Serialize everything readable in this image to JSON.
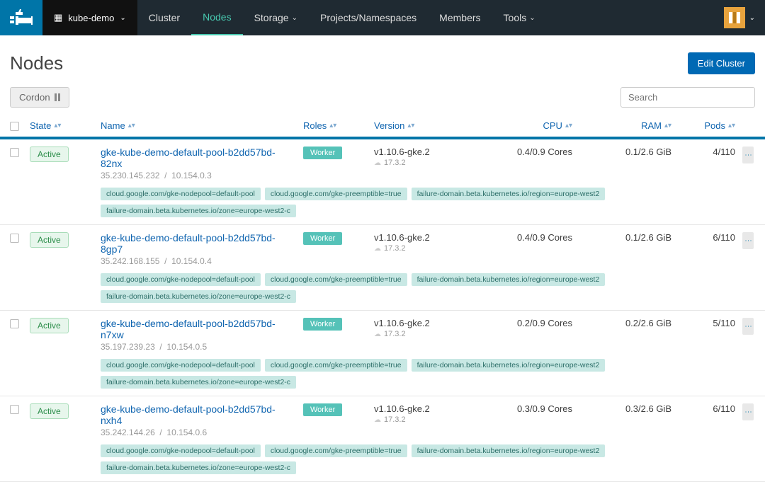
{
  "nav": {
    "cluster_name": "kube-demo",
    "items": [
      {
        "label": "Cluster",
        "active": false,
        "has_dd": false
      },
      {
        "label": "Nodes",
        "active": true,
        "has_dd": false
      },
      {
        "label": "Storage",
        "active": false,
        "has_dd": true
      },
      {
        "label": "Projects/Namespaces",
        "active": false,
        "has_dd": false
      },
      {
        "label": "Members",
        "active": false,
        "has_dd": false
      },
      {
        "label": "Tools",
        "active": false,
        "has_dd": true
      }
    ]
  },
  "page": {
    "title": "Nodes",
    "edit_button": "Edit Cluster"
  },
  "toolbar": {
    "cordon": "Cordon",
    "search_placeholder": "Search"
  },
  "columns": {
    "state": "State",
    "name": "Name",
    "roles": "Roles",
    "version": "Version",
    "cpu": "CPU",
    "ram": "RAM",
    "pods": "Pods"
  },
  "role_label": "Worker",
  "labels": [
    "cloud.google.com/gke-nodepool=default-pool",
    "cloud.google.com/gke-preemptible=true",
    "failure-domain.beta.kubernetes.io/region=europe-west2",
    "failure-domain.beta.kubernetes.io/zone=europe-west2-c"
  ],
  "rows": [
    {
      "state": "Active",
      "name": "gke-kube-demo-default-pool-b2dd57bd-82nx",
      "ext_ip": "35.230.145.232",
      "int_ip": "10.154.0.3",
      "version": "v1.10.6-gke.2",
      "docker": "17.3.2",
      "cpu": "0.4/0.9 Cores",
      "ram": "0.1/2.6 GiB",
      "pods": "4/110"
    },
    {
      "state": "Active",
      "name": "gke-kube-demo-default-pool-b2dd57bd-8gp7",
      "ext_ip": "35.242.168.155",
      "int_ip": "10.154.0.4",
      "version": "v1.10.6-gke.2",
      "docker": "17.3.2",
      "cpu": "0.4/0.9 Cores",
      "ram": "0.1/2.6 GiB",
      "pods": "6/110"
    },
    {
      "state": "Active",
      "name": "gke-kube-demo-default-pool-b2dd57bd-n7xw",
      "ext_ip": "35.197.239.23",
      "int_ip": "10.154.0.5",
      "version": "v1.10.6-gke.2",
      "docker": "17.3.2",
      "cpu": "0.2/0.9 Cores",
      "ram": "0.2/2.6 GiB",
      "pods": "5/110"
    },
    {
      "state": "Active",
      "name": "gke-kube-demo-default-pool-b2dd57bd-nxh4",
      "ext_ip": "35.242.144.26",
      "int_ip": "10.154.0.6",
      "version": "v1.10.6-gke.2",
      "docker": "17.3.2",
      "cpu": "0.3/0.9 Cores",
      "ram": "0.3/2.6 GiB",
      "pods": "6/110"
    }
  ]
}
